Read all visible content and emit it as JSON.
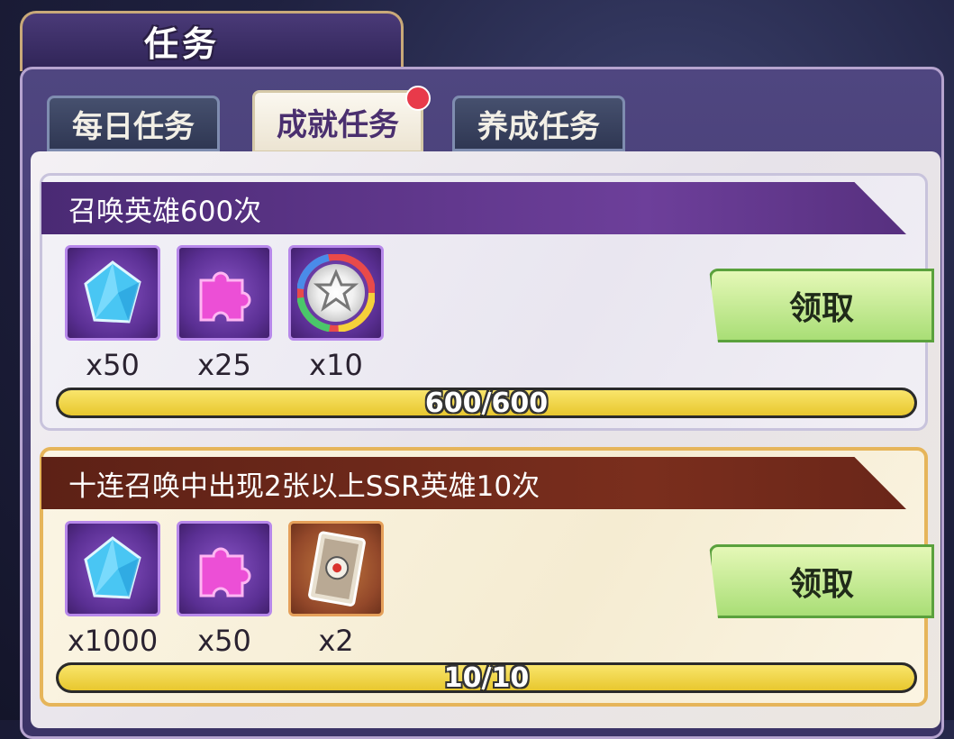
{
  "header": {
    "title": "任务"
  },
  "tabs": [
    {
      "label": "每日任务",
      "active": false
    },
    {
      "label": "成就任务",
      "active": true,
      "has_notification": true
    },
    {
      "label": "养成任务",
      "active": false
    }
  ],
  "quests": [
    {
      "title": "召唤英雄600次",
      "rewards": [
        {
          "icon": "crystal-icon",
          "quantity": "x50"
        },
        {
          "icon": "puzzle-piece-icon",
          "quantity": "x25"
        },
        {
          "icon": "rainbow-medal-icon",
          "quantity": "x10"
        }
      ],
      "claim_label": "领取",
      "progress_text": "600/600",
      "progress_fraction": 1.0
    },
    {
      "title": "十连召唤中出现2张以上SSR英雄10次",
      "rewards": [
        {
          "icon": "crystal-icon",
          "quantity": "x1000"
        },
        {
          "icon": "puzzle-piece-icon",
          "quantity": "x50"
        },
        {
          "icon": "card-icon",
          "quantity": "x2"
        }
      ],
      "claim_label": "领取",
      "progress_text": "10/10",
      "progress_fraction": 1.0
    }
  ],
  "colors": {
    "accent_purple": "#5a2f93",
    "accent_gold": "#e6b55a",
    "claim_green": "#a9de76",
    "progress_yellow": "#e8c72e",
    "notification_red": "#e83a4a"
  }
}
